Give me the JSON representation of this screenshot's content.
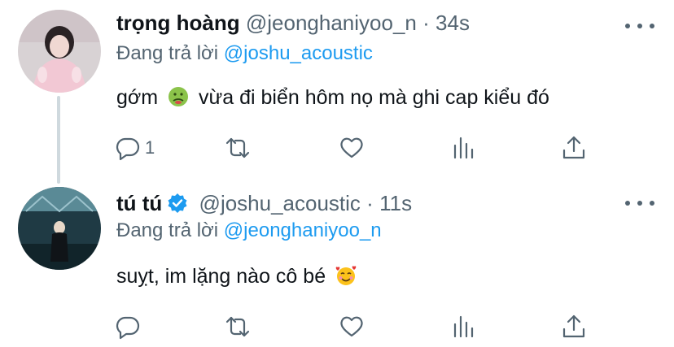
{
  "tweets": [
    {
      "name": "trọng hoàng",
      "handle": "@jeonghaniyoo_n",
      "separator": "·",
      "time": "34s",
      "replying_prefix": "Đang trả lời",
      "replying_to": "@joshu_acoustic",
      "text_before": "gớm",
      "emoji": "nauseated-face",
      "text_after": "vừa đi biển hôm nọ mà ghi cap kiểu đó",
      "reply_count": "1",
      "verified": false
    },
    {
      "name": "tú tú",
      "handle": "@joshu_acoustic",
      "separator": "·",
      "time": "11s",
      "replying_prefix": "Đang trả lời",
      "replying_to": "@jeonghaniyoo_n",
      "text_before": "suỵt, im lặng nào cô bé",
      "emoji": "smiling-face-with-hearts",
      "text_after": "",
      "reply_count": "",
      "verified": true
    }
  ],
  "colors": {
    "link": "#1d9bf0",
    "secondary": "#536471",
    "primary": "#0f1419",
    "thread_line": "#cfd9de"
  }
}
